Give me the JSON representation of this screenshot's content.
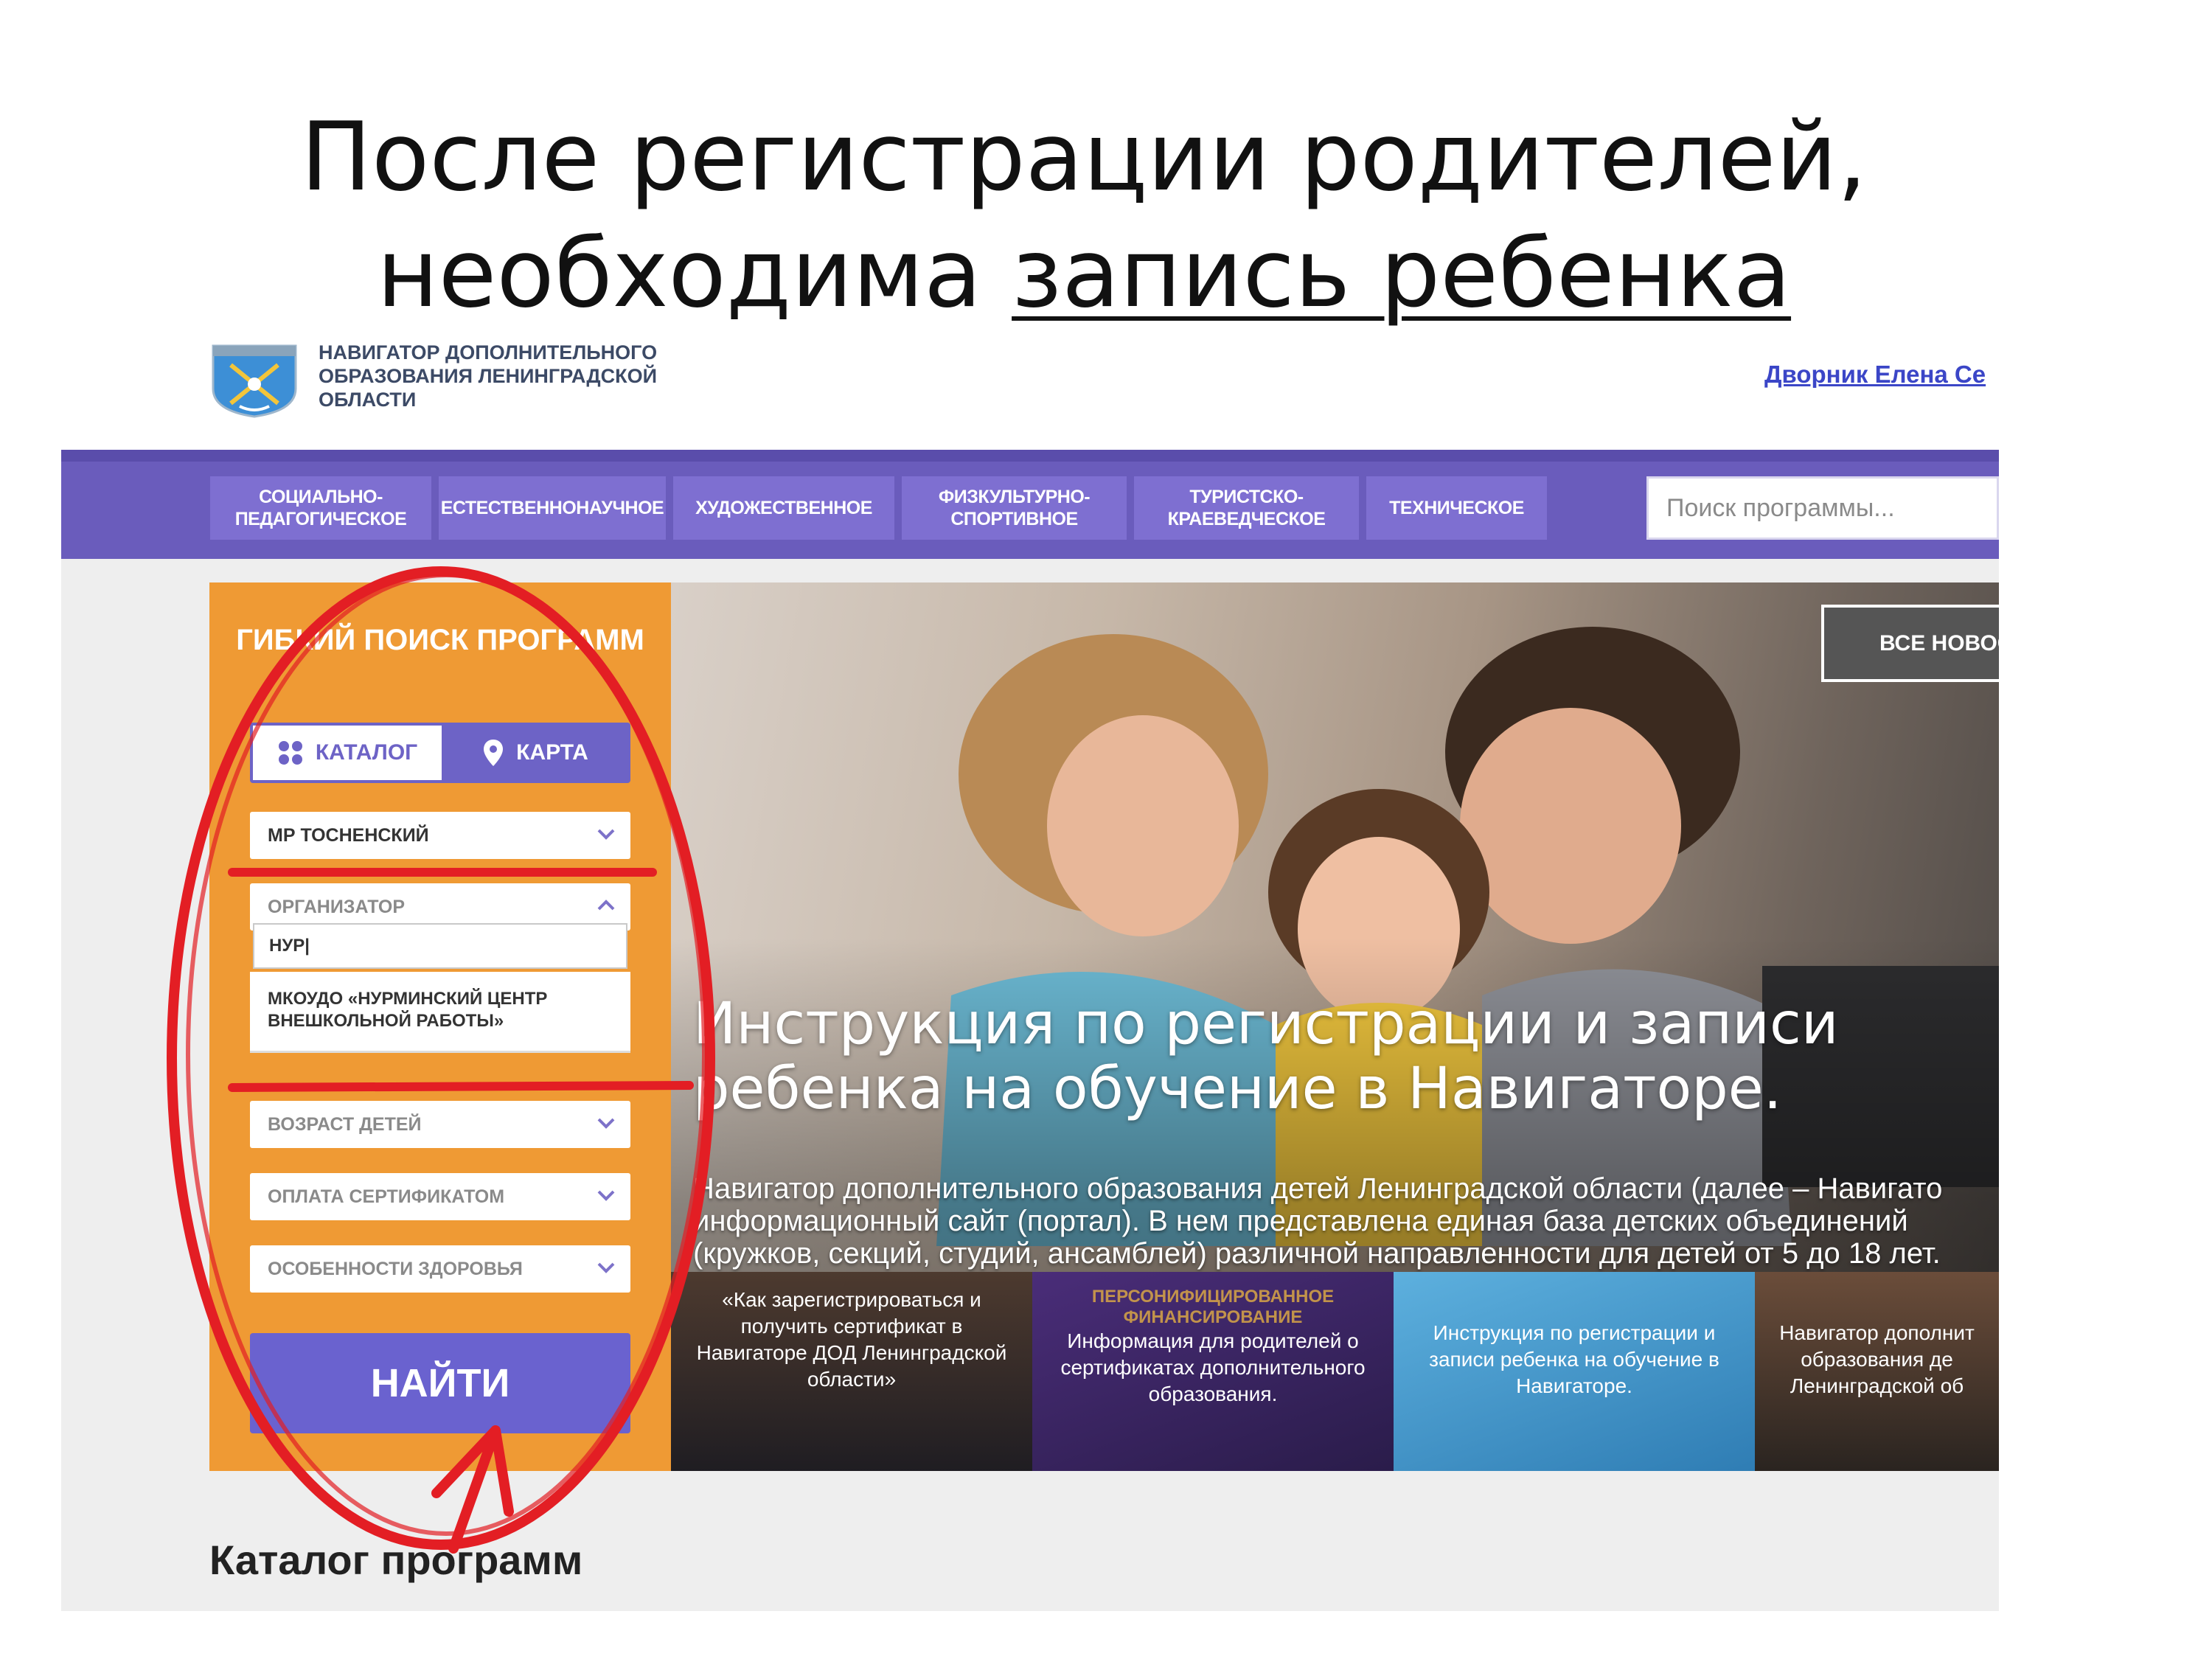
{
  "slide": {
    "title_line1": "После регистрации родителей,",
    "title_line2_plain": "необходима ",
    "title_line2_underlined": "запись ребенка"
  },
  "site": {
    "logo_text": "НАВИГАТОР ДОПОЛНИТЕЛЬНОГО ОБРАЗОВАНИЯ ЛЕНИНГРАДСКОЙ ОБЛАСТИ",
    "logo_icon": "coat-of-arms-icon",
    "user_link": "Дворник Елена Се"
  },
  "nav": {
    "items": [
      {
        "label": "СОЦИАЛЬНО-ПЕДАГОГИЧЕСКОЕ"
      },
      {
        "label": "ЕСТЕСТВЕННОНАУЧНОЕ"
      },
      {
        "label": "ХУДОЖЕСТВЕННОЕ"
      },
      {
        "label": "ФИЗКУЛЬТУРНО-СПОРТИВНОЕ"
      },
      {
        "label": "ТУРИСТСКО-КРАЕВЕДЧЕСКОЕ"
      },
      {
        "label": "ТЕХНИЧЕСКОЕ"
      }
    ],
    "search_placeholder": "Поиск программы..."
  },
  "filter": {
    "title": "ГИБКИЙ ПОИСК ПРОГРАММ",
    "tab_catalog": "КАТАЛОГ",
    "tab_map": "КАРТА",
    "municipality": "МР ТОСНЕНСКИЙ",
    "organizer_label": "ОРГАНИЗАТОР",
    "organizer_query": "НУР|",
    "organizer_option": "МКОУДО «НУРМИНСКИЙ ЦЕНТР ВНЕШКОЛЬНОЙ РАБОТЫ»",
    "age_label": "ВОЗРАСТ ДЕТЕЙ",
    "certificate_label": "ОПЛАТА СЕРТИФИКАТОМ",
    "health_label": "ОСОБЕННОСТИ ЗДОРОВЬЯ",
    "find_button": "НАЙТИ"
  },
  "hero": {
    "news_button": "ВСЕ НОВОС",
    "title": "Инструкция по регистрации и записи ребенка на обучение в Навигаторе.",
    "description": "Навигатор дополнительного образования детей Ленинградской области (далее – Навигато информационный сайт (портал). В нем представлена единая база детских объединений (кружков, секций, студий, ансамблей) различной направленности для детей от 5 до 18 лет.",
    "cards": [
      {
        "text": "«Как зарегистрироваться и получить сертификат в Навигаторе ДОД Ленинградской области»"
      },
      {
        "header": "ПЕРСОНИФИЦИРОВАННОЕ ФИНАНСИРОВАНИЕ",
        "text": "Информация для родителей о сертификатах дополнительного образования."
      },
      {
        "text": "Инструкция по регистрации и записи ребенка на обучение в Навигаторе."
      },
      {
        "text": "Навигатор дополнит образования де Ленинградской об"
      }
    ]
  },
  "catalog_heading": "Каталог программ",
  "colors": {
    "nav_purple": "#6a5cbc",
    "filter_orange": "#ef9a34",
    "button_purple": "#6a62cf",
    "annotation_red": "#e31e24",
    "link_blue": "#3b46c7"
  }
}
